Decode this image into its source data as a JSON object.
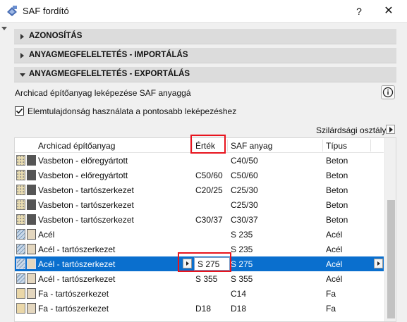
{
  "window": {
    "title": "SAF fordító",
    "help": "?",
    "close": "✕"
  },
  "sections": [
    {
      "label": "AZONOSÍTÁS",
      "expanded": false
    },
    {
      "label": "ANYAGMEGFELELTETÉS - IMPORTÁLÁS",
      "expanded": false
    },
    {
      "label": "ANYAGMEGFELELTETÉS - EXPORTÁLÁS",
      "expanded": true
    }
  ],
  "export": {
    "description": "Archicad építőanyag leképezése SAF anyaggá",
    "checkbox_label": "Elemtulajdonság használata a pontosabb leképezéshez",
    "checkbox_checked": true,
    "strength_label": "Szilárdsági osztály"
  },
  "table": {
    "headers": [
      "Archicad építőanyag",
      "Érték",
      "SAF anyag",
      "Típus"
    ],
    "rows": [
      {
        "material": "Vasbeton - előregyártott",
        "value": "",
        "saf": "C40/50",
        "type": "Beton",
        "swatch": "concrete",
        "selected": false
      },
      {
        "material": "Vasbeton - előregyártott",
        "value": "C50/60",
        "saf": "C50/60",
        "type": "Beton",
        "swatch": "concrete",
        "selected": false
      },
      {
        "material": "Vasbeton - tartószerkezet",
        "value": "C20/25",
        "saf": "C25/30",
        "type": "Beton",
        "swatch": "concrete",
        "selected": false
      },
      {
        "material": "Vasbeton - tartószerkezet",
        "value": "",
        "saf": "C25/30",
        "type": "Beton",
        "swatch": "concrete",
        "selected": false
      },
      {
        "material": "Vasbeton - tartószerkezet",
        "value": "C30/37",
        "saf": "C30/37",
        "type": "Beton",
        "swatch": "concrete",
        "selected": false
      },
      {
        "material": "Acél",
        "value": "",
        "saf": "S 235",
        "type": "Acél",
        "swatch": "steel",
        "selected": false
      },
      {
        "material": "Acél - tartószerkezet",
        "value": "",
        "saf": "S 235",
        "type": "Acél",
        "swatch": "steel",
        "selected": false
      },
      {
        "material": "Acél - tartószerkezet",
        "value": "S 275",
        "saf": "S 275",
        "type": "Acél",
        "swatch": "steel",
        "selected": true
      },
      {
        "material": "Acél - tartószerkezet",
        "value": "S 355",
        "saf": "S 355",
        "type": "Acél",
        "swatch": "steel",
        "selected": false
      },
      {
        "material": "Fa - tartószerkezet",
        "value": "",
        "saf": "C14",
        "type": "Fa",
        "swatch": "wood",
        "selected": false
      },
      {
        "material": "Fa - tartószerkezet",
        "value": "D18",
        "saf": "D18",
        "type": "Fa",
        "swatch": "wood",
        "selected": false
      }
    ]
  },
  "colors": {
    "selection": "#0a6fce",
    "highlight": "#e8141e",
    "concrete_swatch": "#e9dcb0",
    "steel_swatch": "#c9d8e8",
    "wood_swatch": "#ead7a8",
    "fill_dark": "#555555",
    "fill_light_tan": "#e4d7bf"
  }
}
